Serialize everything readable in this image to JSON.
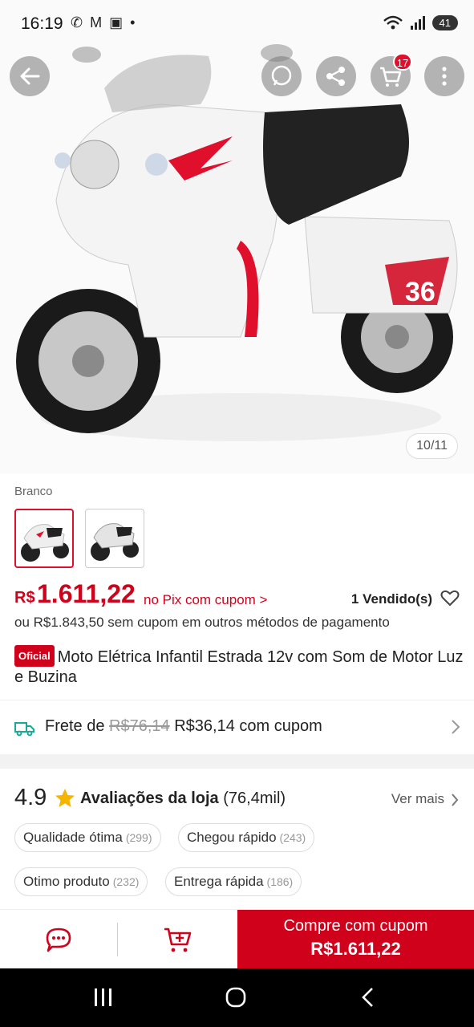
{
  "status_bar": {
    "time": "16:19",
    "notif_icons": "✆ M ▣ •",
    "battery": "41"
  },
  "top_actions": {
    "cart_count": "17"
  },
  "gallery": {
    "counter": "10/11"
  },
  "variant": {
    "label": "Branco"
  },
  "price": {
    "currency": "R$",
    "value": "1.611,22",
    "pix_text": "no Pix com cupom >",
    "sold": "1 Vendido(s)",
    "alt_text": "ou R$1.843,50 sem cupom em outros métodos de pagamento"
  },
  "product": {
    "badge": "Oficial",
    "title": "Moto Elétrica Infantil Estrada 12v com Som de Motor Luz e Buzina"
  },
  "shipping": {
    "prefix": "Frete de",
    "old": "R$76,14",
    "new": "R$36,14 com cupom"
  },
  "store": {
    "score": "4.9",
    "label": "Avaliações da loja",
    "count": "(76,4mil)",
    "more": "Ver mais",
    "chips": [
      {
        "text": "Qualidade ótima",
        "count": "(299)"
      },
      {
        "text": "Chegou rápido",
        "count": "(243)"
      },
      {
        "text": "Otimo produto",
        "count": "(232)"
      },
      {
        "text": "Entrega rápida",
        "count": "(186)"
      }
    ]
  },
  "bottom": {
    "buy_line1": "Compre com cupom",
    "buy_line2": "R$1.611,22"
  },
  "colors": {
    "accent": "#d0021b"
  }
}
